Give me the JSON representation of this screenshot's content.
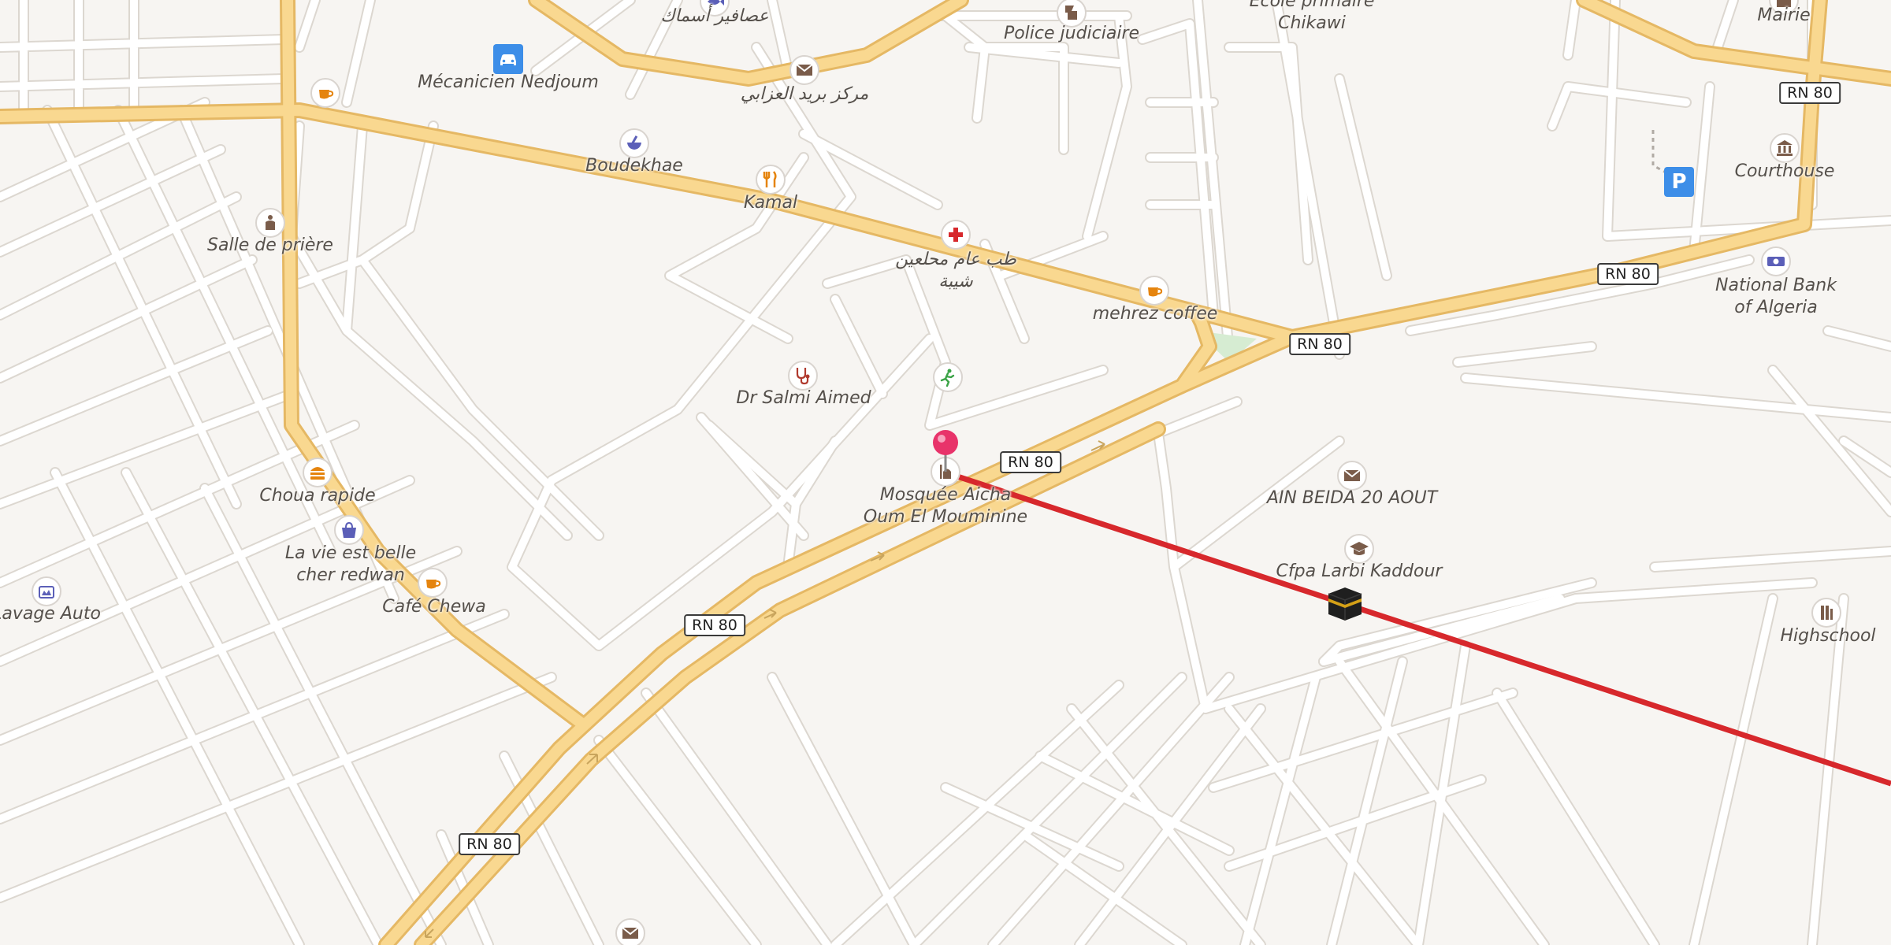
{
  "map": {
    "labels": {
      "ecole": "Ecole primaire\nChikawi",
      "mairie": "Mairie",
      "police": "Police judiciaire",
      "asmak": "عصافير أسماك",
      "mecanicien": "Mécanicien Nedjoum",
      "poste": "مركز بريد العزابي",
      "boudekhae": "Boudekhae",
      "kamal": "Kamal",
      "medecin": "طب عام محلعين\nشيبة",
      "courthouse": "Courthouse",
      "salle": "Salle de prière",
      "mehrez": "mehrez coffee",
      "bank": "National Bank\nof Algeria",
      "salmi": "Dr Salmi Aimed",
      "mosquee": "Mosquée Aicha\nOum El Mouminine",
      "ain_beida": "AIN BEIDA 20 AOUT",
      "choua": "Choua rapide",
      "lavie": "La vie est belle\ncher redwan",
      "cfpa": "Cfpa Larbi Kaddour",
      "lavage": "Lavage Auto",
      "cafe_chewa": "Café Chewa",
      "highschool": "Highschool"
    },
    "road_shields": [
      "RN 80",
      "RN 80",
      "RN 80",
      "RN 80",
      "RN 80",
      "RN 80"
    ],
    "parking_label": "P",
    "icons": {
      "selected_pin": "pink-location-pin",
      "qibla_target": "kaaba-icon",
      "qibla_line_color": "#d7282c"
    },
    "colors": {
      "background": "#f7f5f2",
      "primary_road": "#f6d38a",
      "minor_road": "#ffffff",
      "poi_brown": "#7a5c4a",
      "poi_orange": "#e5840e",
      "poi_blue": "#5b5fb8"
    }
  }
}
